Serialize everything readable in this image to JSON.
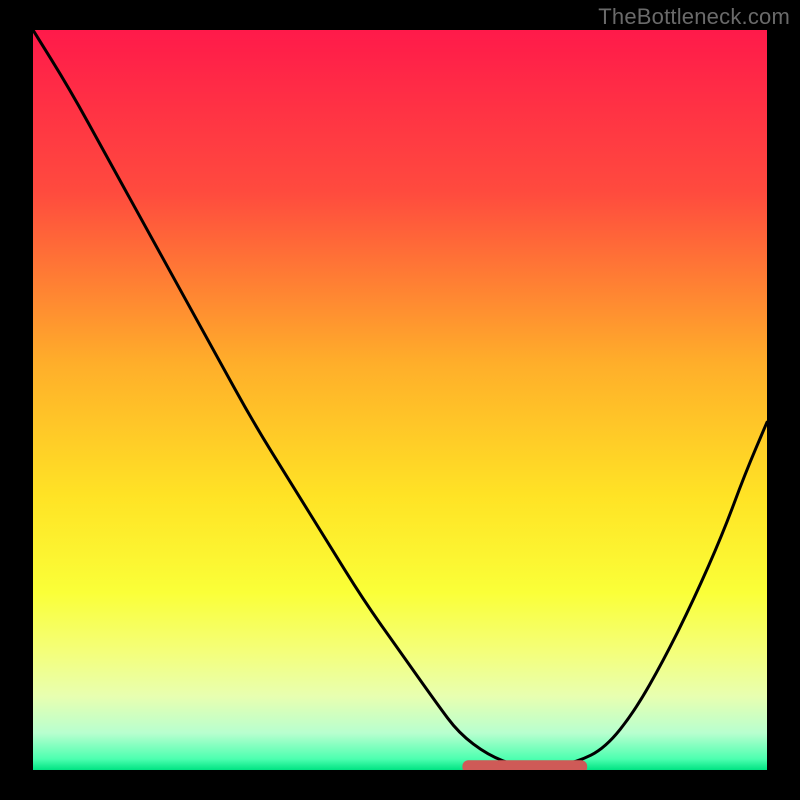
{
  "watermark": "TheBottleneck.com",
  "colors": {
    "background": "#000000",
    "watermark_text": "#6a6a6a",
    "curve": "#000000",
    "marker": "#cf5a57",
    "gradient_stops": [
      {
        "offset": 0.0,
        "color": "#ff1a4a"
      },
      {
        "offset": 0.22,
        "color": "#ff4b3e"
      },
      {
        "offset": 0.45,
        "color": "#ffae2a"
      },
      {
        "offset": 0.63,
        "color": "#ffe325"
      },
      {
        "offset": 0.76,
        "color": "#faff38"
      },
      {
        "offset": 0.84,
        "color": "#f4ff7a"
      },
      {
        "offset": 0.9,
        "color": "#e8ffb0"
      },
      {
        "offset": 0.95,
        "color": "#b8ffcf"
      },
      {
        "offset": 0.985,
        "color": "#4dffb0"
      },
      {
        "offset": 1.0,
        "color": "#00e383"
      }
    ]
  },
  "chart_data": {
    "type": "line",
    "title": "",
    "xlabel": "",
    "ylabel": "",
    "xlim": [
      0,
      1
    ],
    "ylim": [
      0,
      1
    ],
    "series": [
      {
        "name": "bottleneck-curve",
        "x": [
          0.0,
          0.05,
          0.1,
          0.15,
          0.2,
          0.25,
          0.3,
          0.35,
          0.4,
          0.45,
          0.5,
          0.55,
          0.58,
          0.62,
          0.66,
          0.7,
          0.74,
          0.78,
          0.82,
          0.86,
          0.9,
          0.94,
          0.97,
          1.0
        ],
        "y": [
          1.0,
          0.92,
          0.83,
          0.74,
          0.65,
          0.56,
          0.47,
          0.39,
          0.31,
          0.23,
          0.16,
          0.09,
          0.05,
          0.02,
          0.005,
          0.005,
          0.01,
          0.03,
          0.08,
          0.15,
          0.23,
          0.32,
          0.4,
          0.47
        ]
      }
    ],
    "annotations": [
      {
        "name": "optimal-range",
        "shape": "pill",
        "x_start": 0.585,
        "x_end": 0.755,
        "y": 0.005
      }
    ]
  }
}
